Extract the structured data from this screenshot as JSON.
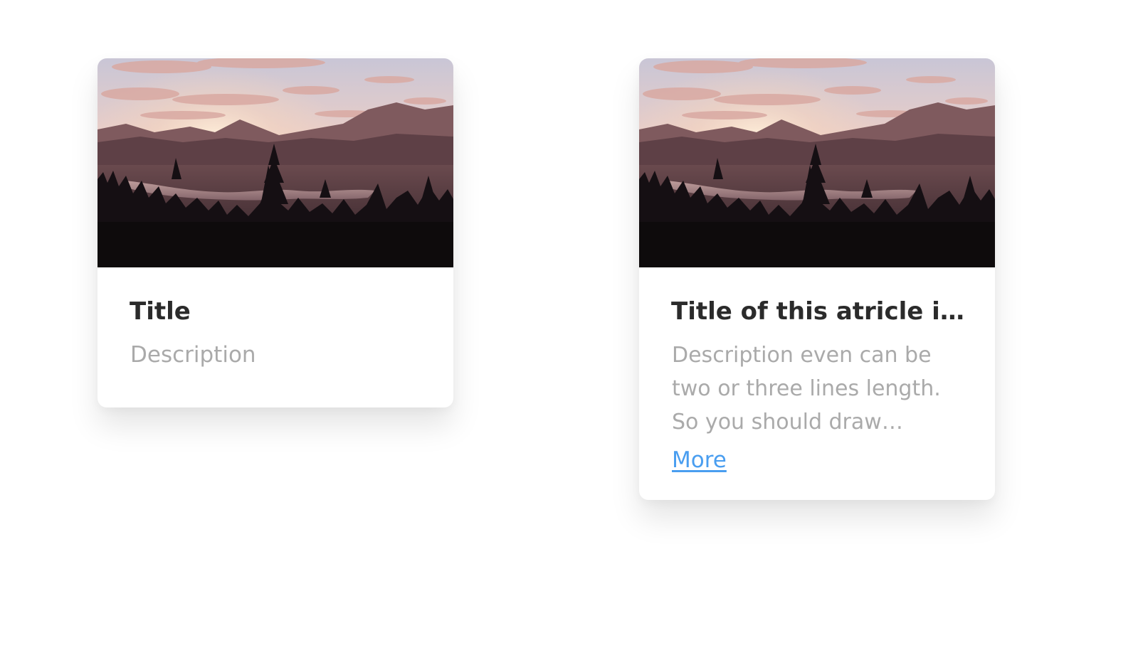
{
  "cards": [
    {
      "image": "sunset-mountain-lake-landscape",
      "title": "Title",
      "description": "Description"
    },
    {
      "image": "sunset-mountain-lake-landscape",
      "title": "Title of this atricle is...",
      "description": "Description even can be two or three lines length. So you should draw…",
      "more_label": "More"
    }
  ],
  "colors": {
    "title": "#2b2b2b",
    "description": "#aaaaaa",
    "link": "#4a9ef0",
    "card": "#ffffff"
  }
}
